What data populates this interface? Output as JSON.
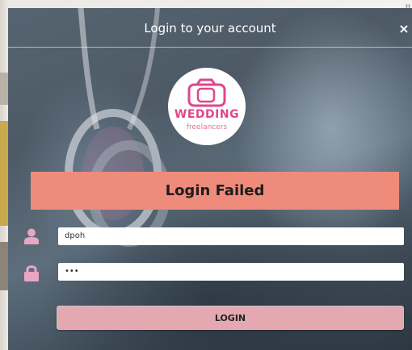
{
  "background_page": {
    "corner_text": "H"
  },
  "modal": {
    "title": "Login to your account",
    "close_label": "×",
    "logo": {
      "word": "WEDDING",
      "sub": "freelancers"
    },
    "alert": {
      "message": "Login Failed",
      "color": "#ef8b7b"
    },
    "username": {
      "icon": "user-icon",
      "value": "dpoh"
    },
    "password": {
      "icon": "lock-icon",
      "value": "•••"
    },
    "login_button": {
      "label": "LOGIN",
      "color": "#e4a8b1"
    }
  },
  "colors": {
    "brand_pink": "#e0468c",
    "icon_pink": "#e8a6c3"
  }
}
